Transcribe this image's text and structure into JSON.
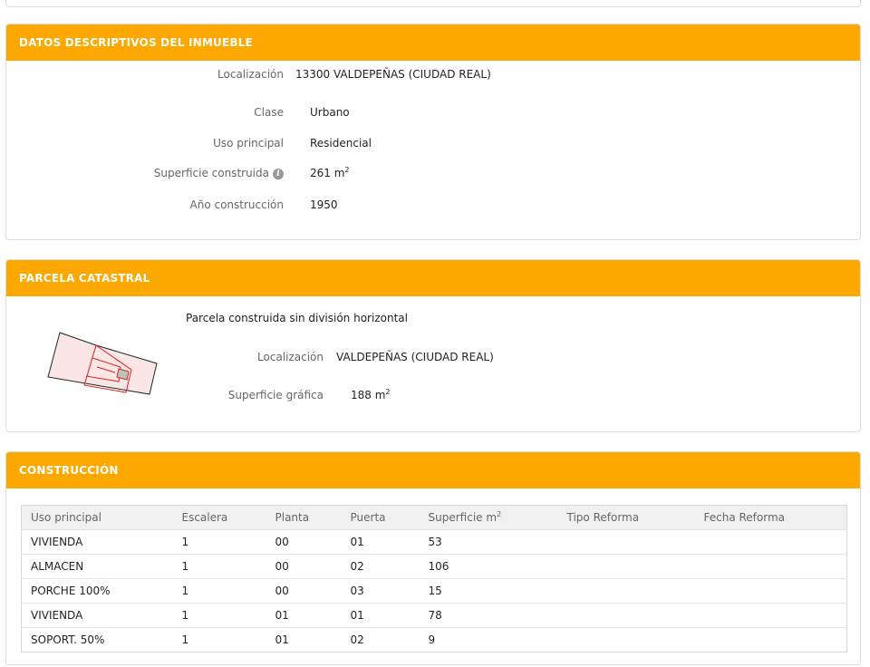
{
  "datos": {
    "header": "DATOS DESCRIPTIVOS DEL INMUEBLE",
    "localizacion_label": "Localización",
    "localizacion_value": "13300 VALDEPEÑAS (CIUDAD REAL)",
    "clase_label": "Clase",
    "clase_value": "Urbano",
    "uso_label": "Uso principal",
    "uso_value": "Residencial",
    "superficie_label": "Superficie construida",
    "superficie_value": "261 m",
    "superficie_unit_sup": "2",
    "info_icon": "info-icon",
    "anio_label": "Año construcción",
    "anio_value": "1950"
  },
  "parcela": {
    "header": "PARCELA CATASTRAL",
    "tipo": "Parcela construida sin división horizontal",
    "localizacion_label": "Localización",
    "localizacion_value": "VALDEPEÑAS (CIUDAD REAL)",
    "superficie_label": "Superficie gráfica",
    "superficie_value": "188 m",
    "superficie_unit_sup": "2",
    "colors": {
      "outline": "#222222",
      "fill": "#fbe6e6",
      "inner": "#e02020",
      "core": "#b8c8b8"
    }
  },
  "construccion": {
    "header": "CONSTRUCCIÓN",
    "columns": [
      "Uso principal",
      "Escalera",
      "Planta",
      "Puerta",
      "Superficie m",
      "Tipo Reforma",
      "Fecha Reforma"
    ],
    "superficie_sup": "2",
    "rows": [
      [
        "VIVIENDA",
        "1",
        "00",
        "01",
        "53",
        "",
        ""
      ],
      [
        "ALMACEN",
        "1",
        "00",
        "02",
        "106",
        "",
        ""
      ],
      [
        "PORCHE 100%",
        "1",
        "00",
        "03",
        "15",
        "",
        ""
      ],
      [
        "VIVIENDA",
        "1",
        "01",
        "01",
        "78",
        "",
        ""
      ],
      [
        "SOPORT. 50%",
        "1",
        "01",
        "02",
        "9",
        "",
        ""
      ]
    ]
  },
  "theme": {
    "accent": "#fca800"
  }
}
